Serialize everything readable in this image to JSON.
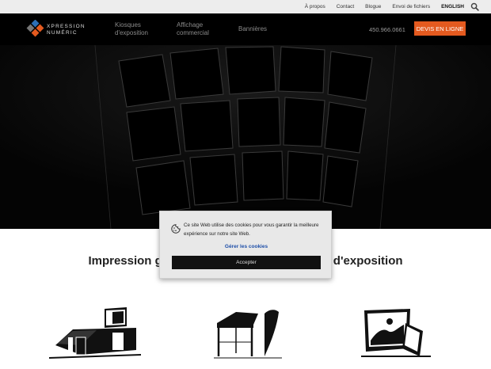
{
  "topbar": {
    "links": [
      "À propos",
      "Contact",
      "Blogue",
      "Envoi de fichiers",
      "ENGLISH"
    ],
    "search_icon": "search-icon"
  },
  "nav": {
    "logo_line1": "XPRESSION",
    "logo_line2": "NUMÉRIC",
    "items": [
      {
        "line1": "Kiosques",
        "line2": "d'exposition"
      },
      {
        "line1": "Affichage",
        "line2": "commercial"
      },
      {
        "line1": "Bannières",
        "line2": ""
      }
    ],
    "phone": "450.966.0661",
    "quote_label": "DEVIS EN LIGNE",
    "accent_color": "#e45a1f"
  },
  "main": {
    "headline_left": "Impression g",
    "headline_right": "d'exposition"
  },
  "cookie": {
    "message": "Ce site Web utilise des cookies pour vous garantir la meilleure expérience sur notre site Web.",
    "manage_label": "Gérer les cookies",
    "accept_label": "Accepter"
  }
}
